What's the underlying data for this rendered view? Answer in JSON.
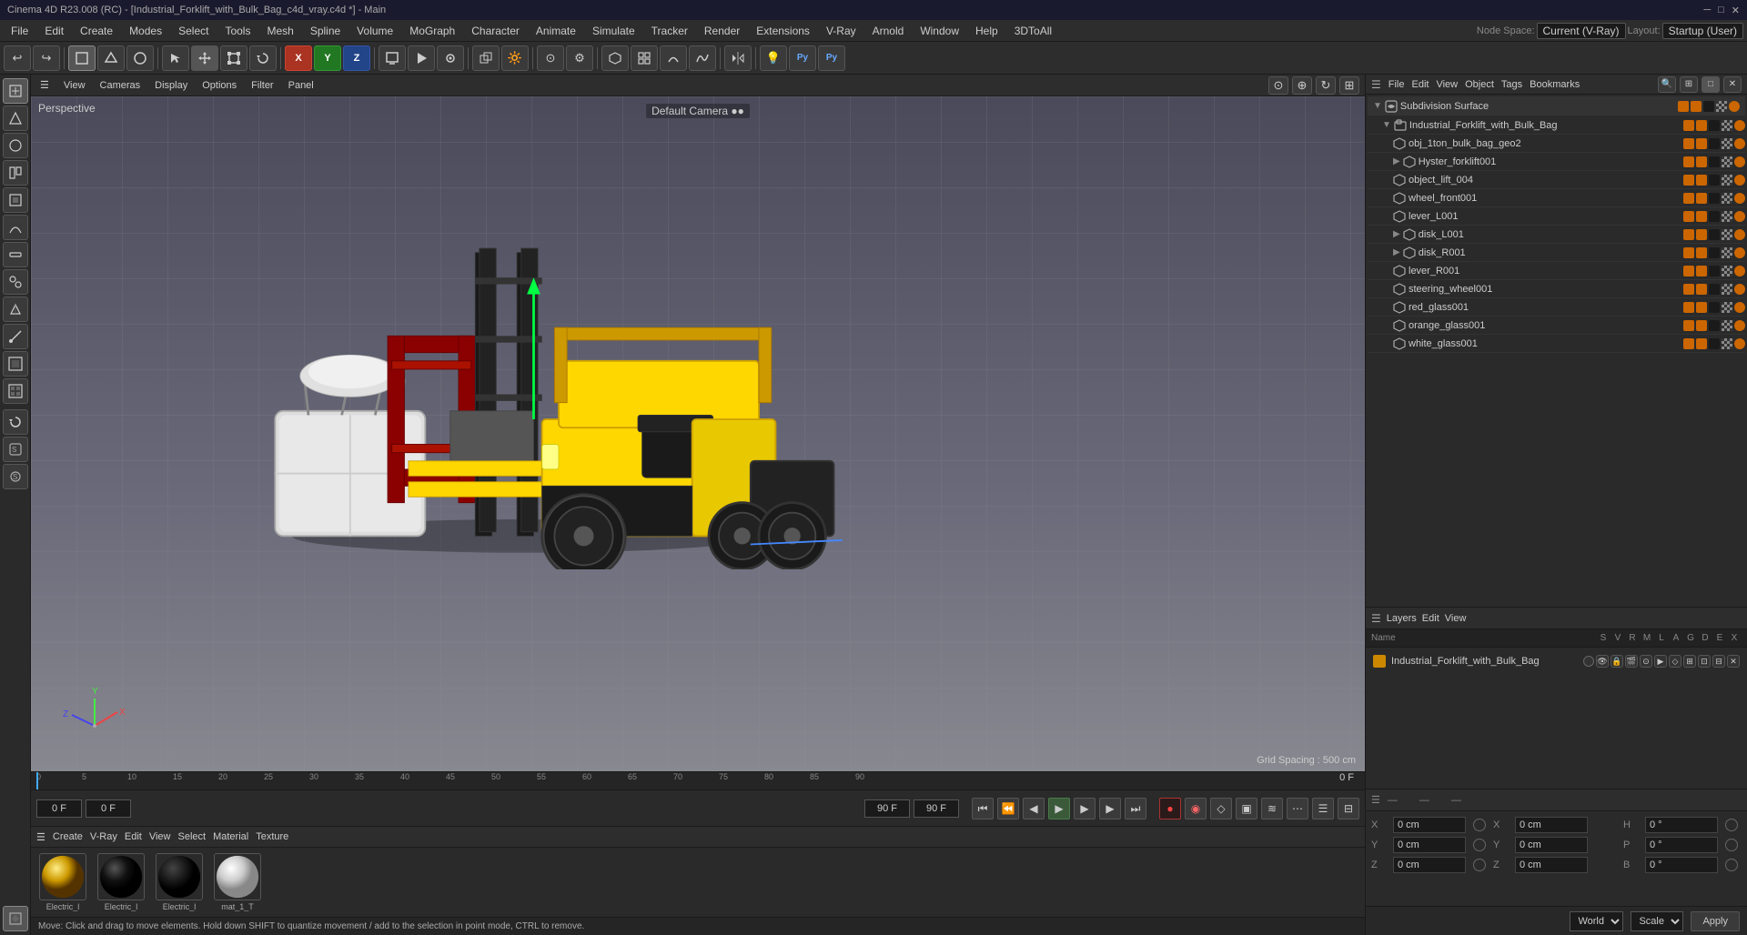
{
  "app": {
    "title": "Cinema 4D R23.008 (RC) - [Industrial_Forklift_with_Bulk_Bag_c4d_vray.c4d *] - Main",
    "window_controls": [
      "minimize",
      "maximize",
      "close"
    ]
  },
  "menu_bar": {
    "items": [
      "File",
      "Edit",
      "Create",
      "Modes",
      "Select",
      "Tools",
      "Mesh",
      "Spline",
      "Volume",
      "MoGraph",
      "Character",
      "Animate",
      "Simulate",
      "Tracker",
      "Render",
      "Extensions",
      "V-Ray",
      "Arnold",
      "Window",
      "Help",
      "3DToAll"
    ]
  },
  "node_space": {
    "label": "Node Space:",
    "value": "Current (V-Ray)"
  },
  "layout": {
    "label": "Layout:",
    "value": "Startup (User)"
  },
  "viewport": {
    "camera_label": "Default Camera ●●",
    "perspective_label": "Perspective",
    "grid_spacing": "Grid Spacing : 500 cm",
    "view_menu": [
      "View",
      "Cameras",
      "Display",
      "Options",
      "Filter",
      "Panel"
    ]
  },
  "timeline": {
    "current_frame": "0 F",
    "start_frame": "0 F",
    "end_frame": "90 F",
    "preview_end": "90 F",
    "frame_markers": [
      "0",
      "5",
      "10",
      "15",
      "20",
      "25",
      "30",
      "35",
      "40",
      "45",
      "50",
      "55",
      "60",
      "65",
      "70",
      "75",
      "80",
      "85",
      "90"
    ],
    "frame_display": "0 F"
  },
  "material_panel": {
    "menus": [
      "Create",
      "V-Ray",
      "Edit",
      "View",
      "Select",
      "Material",
      "Texture"
    ],
    "materials": [
      {
        "name": "Electric_l",
        "type": "glossy_yellow"
      },
      {
        "name": "Electric_l",
        "type": "black_sphere"
      },
      {
        "name": "Electric_l",
        "type": "dark_glossy"
      },
      {
        "name": "mat_1_T",
        "type": "white_matte"
      }
    ]
  },
  "status_bar": {
    "text": "Move: Click and drag to move elements. Hold down SHIFT to quantize movement / add to the selection in point mode, CTRL to remove."
  },
  "object_manager": {
    "title": "Subdivision Surface",
    "menus": [
      "File",
      "Edit",
      "View",
      "Object",
      "Tags",
      "Bookmarks"
    ],
    "objects": [
      {
        "name": "Subdivision Surface",
        "level": 0,
        "has_arrow": true,
        "type": "subdiv"
      },
      {
        "name": "Industrial_Forklift_with_Bulk_Bag",
        "level": 1,
        "has_arrow": true,
        "type": "group"
      },
      {
        "name": "obj_1ton_bulk_bag_geo2",
        "level": 2,
        "has_arrow": false,
        "type": "mesh"
      },
      {
        "name": "Hyster_forklift001",
        "level": 2,
        "has_arrow": true,
        "type": "mesh"
      },
      {
        "name": "object_lift_004",
        "level": 2,
        "has_arrow": false,
        "type": "mesh"
      },
      {
        "name": "wheel_front001",
        "level": 2,
        "has_arrow": false,
        "type": "mesh"
      },
      {
        "name": "lever_L001",
        "level": 2,
        "has_arrow": false,
        "type": "mesh"
      },
      {
        "name": "disk_L001",
        "level": 2,
        "has_arrow": true,
        "type": "mesh"
      },
      {
        "name": "disk_R001",
        "level": 2,
        "has_arrow": true,
        "type": "mesh"
      },
      {
        "name": "lever_R001",
        "level": 2,
        "has_arrow": false,
        "type": "mesh"
      },
      {
        "name": "steering_wheel001",
        "level": 2,
        "has_arrow": false,
        "type": "mesh"
      },
      {
        "name": "red_glass001",
        "level": 2,
        "has_arrow": false,
        "type": "mesh"
      },
      {
        "name": "orange_glass001",
        "level": 2,
        "has_arrow": false,
        "type": "mesh"
      },
      {
        "name": "white_glass001",
        "level": 2,
        "has_arrow": false,
        "type": "mesh"
      }
    ]
  },
  "layer_manager": {
    "menus": [
      "Layers",
      "Edit",
      "View"
    ],
    "columns": [
      "Name",
      "S",
      "V",
      "R",
      "M",
      "L",
      "A",
      "G",
      "D",
      "E",
      "X"
    ],
    "layers": [
      {
        "name": "Industrial_Forklift_with_Bulk_Bag",
        "color": "#cc8800"
      }
    ]
  },
  "transform": {
    "coords": [
      {
        "axis": "X",
        "pos": "0 cm",
        "rot": "0 °",
        "dim": "H",
        "dim_val": "0 °"
      },
      {
        "axis": "Y",
        "pos": "0 cm",
        "rot": "0 °",
        "dim": "P",
        "dim_val": "0 °"
      },
      {
        "axis": "Z",
        "pos": "0 cm",
        "rot": "0 °",
        "dim": "B",
        "dim_val": "0 °"
      }
    ],
    "coordinate_system": "World",
    "mode": "Scale",
    "apply_label": "Apply"
  },
  "icons": {
    "undo": "↩",
    "redo": "↪",
    "move": "✛",
    "scale": "⊞",
    "rotate": "⟳",
    "select_all": "▣",
    "plus": "+",
    "x_axis": "X",
    "y_axis": "Y",
    "z_axis": "Z",
    "play": "▶",
    "stop": "■",
    "prev": "⏮",
    "next": "⏭",
    "rewind": "⏪",
    "forward": "⏩",
    "record": "⏺"
  }
}
